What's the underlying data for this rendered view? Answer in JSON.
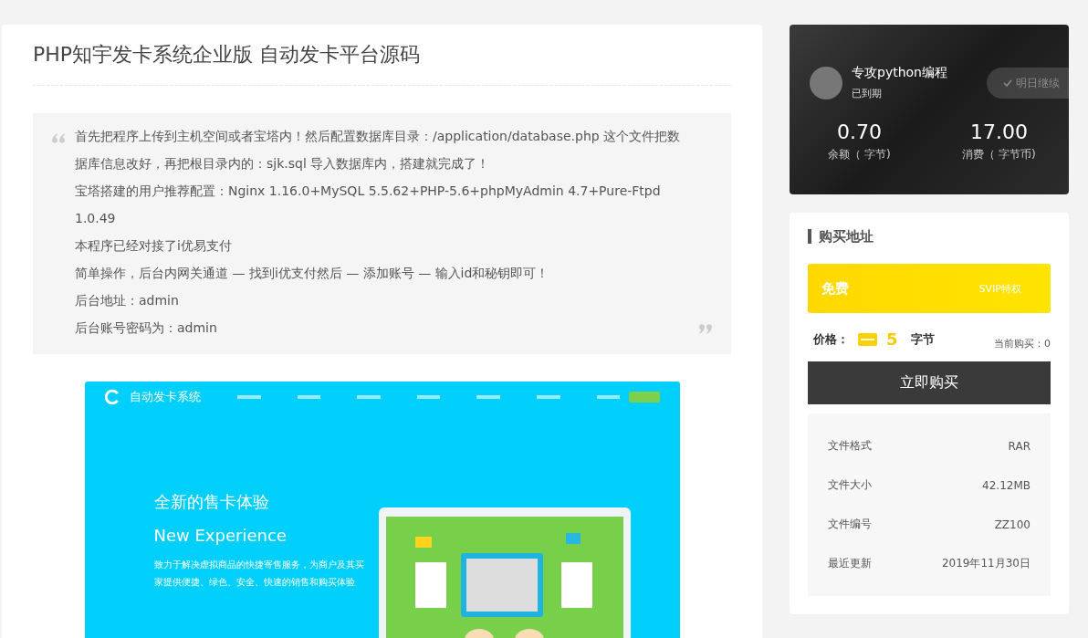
{
  "article": {
    "title": "PHP知宇发卡系统企业版 自动发卡平台源码",
    "quote": [
      "首先把程序上传到主机空间或者宝塔内！然后配置数据库目录：/application/database.php 这个文件把数据库信息改好，再把根目录内的：sjk.sql 导入数据库内，搭建就完成了！",
      "宝塔搭建的用户推荐配置：Nginx 1.16.0+MySQL 5.5.62+PHP-5.6+phpMyAdmin 4.7+Pure-Ftpd 1.0.49",
      "本程序已经对接了i优易支付",
      "简单操作，后台内网关通道 — 找到i优支付然后 — 添加账号 — 输入id和秘钥即可！",
      "后台地址：admin",
      "后台账号密码为：admin"
    ],
    "screenshot": {
      "logo": "自动发卡系统",
      "headline": "全新的售卡体验",
      "subheadline": "New Experience",
      "description": "致力于解决虚拟商品的快捷寄售服务，为商户及其买家提供便捷、绿色、安全、快速的销售和购买体验"
    }
  },
  "user_card": {
    "name": "专攻python编程",
    "status": "已到期",
    "checkin": {
      "label": "明日继续",
      "disabled": true
    },
    "stats": [
      {
        "value": "0.70",
        "label": "余额（ 字节)"
      },
      {
        "value": "17.00",
        "label": "消费（ 字节币)"
      }
    ]
  },
  "purchase": {
    "heading": "购买地址",
    "banner": {
      "left": "免费",
      "right": "SVIP特权"
    },
    "price_label": "价格：",
    "price": "5",
    "unit": "字节",
    "current": "当前购买：0",
    "buy_button": "立即购买",
    "details": [
      {
        "key": "文件格式",
        "value": "RAR"
      },
      {
        "key": "文件大小",
        "value": "42.12MB"
      },
      {
        "key": "文件编号",
        "value": "ZZ100"
      },
      {
        "key": "最近更新",
        "value": "2019年11月30日"
      }
    ]
  }
}
